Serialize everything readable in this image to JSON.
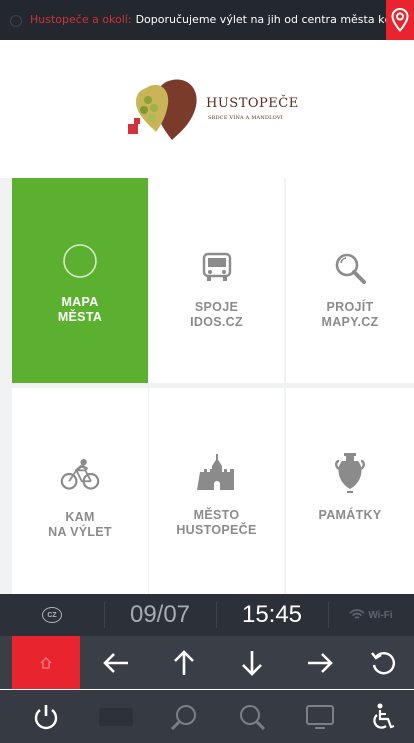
{
  "ticker": {
    "highlight": "Hustopeče a okolí:",
    "message": "Doporučujeme výlet na jih od centra města kde naj..."
  },
  "logo": {
    "title": "HUSTOPEČE",
    "subtitle": "SRDCE VÍNA A MANDLOVÍ"
  },
  "tiles": [
    {
      "label": [
        "MAPA",
        "MĚSTA"
      ],
      "icon": "circle-icon",
      "active": true
    },
    {
      "label": [
        "SPOJE",
        "IDOS.CZ"
      ],
      "icon": "bus-icon",
      "active": false
    },
    {
      "label": [
        "PROJÍT",
        "MAPY.CZ"
      ],
      "icon": "magnifier-icon",
      "active": false
    },
    {
      "label": [
        "KAM",
        "NA VÝLET"
      ],
      "icon": "cyclist-icon",
      "active": false
    },
    {
      "label": [
        "MĚSTO",
        "HUSTOPEČE"
      ],
      "icon": "castle-icon",
      "active": false
    },
    {
      "label": [
        "PAMÁTKY"
      ],
      "icon": "amphora-icon",
      "active": false
    }
  ],
  "status": {
    "language": "CZ",
    "date": "09/07",
    "time": "15:45",
    "wifi": "Wi-Fi"
  },
  "colors": {
    "accent_green": "#5bb12f",
    "accent_red": "#e8252f",
    "dark_bar": "#2c3139"
  }
}
